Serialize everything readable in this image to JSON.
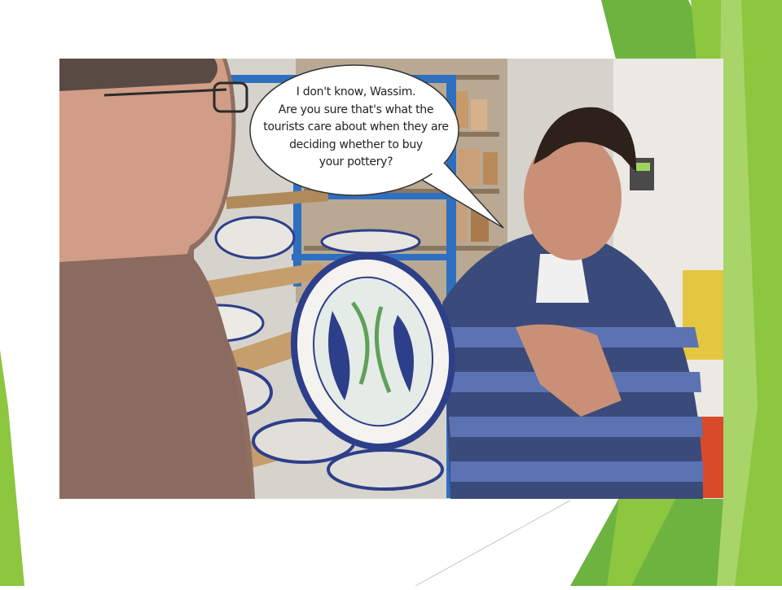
{
  "slide": {
    "accent_colors": [
      "#8dc63f",
      "#6db33f",
      "#b7dc84"
    ]
  },
  "photo": {
    "description_icons": [
      "speech-bubble",
      "ceramic-plate",
      "pottery-shelf"
    ],
    "speech_bubble": {
      "lines": [
        "I don't know, Wassim.",
        "Are you sure that's what the",
        "tourists care about when they are",
        "deciding whether to buy",
        "your pottery?"
      ]
    }
  }
}
